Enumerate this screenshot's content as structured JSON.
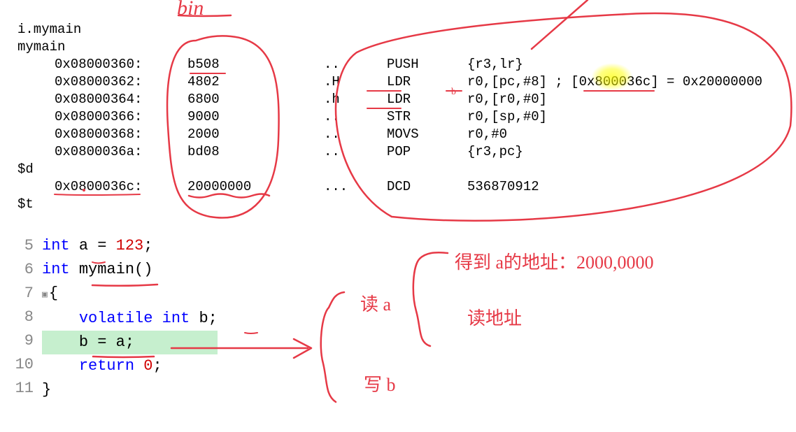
{
  "disasm": {
    "label1": "i.mymain",
    "label2": "mymain",
    "rows": [
      {
        "addr": "0x08000360:",
        "opcode": "b508",
        "ascii": "..",
        "mnem": "PUSH",
        "ops": "{r3,lr}"
      },
      {
        "addr": "0x08000362:",
        "opcode": "4802",
        "ascii": ".H",
        "mnem": "LDR",
        "ops": "r0,[pc,#8] ; [0x800036c] = 0x20000000"
      },
      {
        "addr": "0x08000364:",
        "opcode": "6800",
        "ascii": ".h",
        "mnem": "LDR",
        "ops": "r0,[r0,#0]"
      },
      {
        "addr": "0x08000366:",
        "opcode": "9000",
        "ascii": "..",
        "mnem": "STR",
        "ops": "r0,[sp,#0]"
      },
      {
        "addr": "0x08000368:",
        "opcode": "2000",
        "ascii": "..",
        "mnem": "MOVS",
        "ops": "r0,#0"
      },
      {
        "addr": "0x0800036a:",
        "opcode": "bd08",
        "ascii": "..",
        "mnem": "POP",
        "ops": "{r3,pc}"
      }
    ],
    "label3": "$d",
    "data_row": {
      "addr": "0x0800036c:",
      "opcode": "20000000",
      "ascii": "...",
      "mnem": "DCD",
      "ops": "536870912"
    },
    "label4": "$t"
  },
  "source": {
    "lines": [
      {
        "ln": "5",
        "tokens": [
          {
            "t": "int ",
            "c": "kw-blue"
          },
          {
            "t": "a ",
            "c": "token-black"
          },
          {
            "t": "= ",
            "c": "token-black"
          },
          {
            "t": "123",
            "c": "num-red"
          },
          {
            "t": ";",
            "c": "token-black"
          }
        ]
      },
      {
        "ln": "6",
        "tokens": [
          {
            "t": "int ",
            "c": "kw-blue"
          },
          {
            "t": "mymain",
            "c": "token-black"
          },
          {
            "t": "()",
            "c": "token-black"
          }
        ]
      },
      {
        "ln": "7",
        "fold": true,
        "tokens": [
          {
            "t": "{",
            "c": "token-black"
          }
        ]
      },
      {
        "ln": "8",
        "tokens": [
          {
            "t": "    ",
            "c": ""
          },
          {
            "t": "volatile ",
            "c": "kw-blue"
          },
          {
            "t": "int ",
            "c": "kw-blue"
          },
          {
            "t": "b",
            "c": "token-black"
          },
          {
            "t": ";",
            "c": "token-black"
          }
        ]
      },
      {
        "ln": "9",
        "hl": true,
        "tokens": [
          {
            "t": "    ",
            "c": ""
          },
          {
            "t": "b ",
            "c": "token-black"
          },
          {
            "t": "= ",
            "c": "token-black"
          },
          {
            "t": "a",
            "c": "token-black"
          },
          {
            "t": ";",
            "c": "token-black"
          }
        ]
      },
      {
        "ln": "10",
        "tokens": [
          {
            "t": "    ",
            "c": ""
          },
          {
            "t": "return ",
            "c": "kw-blue"
          },
          {
            "t": "0",
            "c": "num-red"
          },
          {
            "t": ";",
            "c": "token-black"
          }
        ]
      },
      {
        "ln": "11",
        "tokens": [
          {
            "t": "}",
            "c": "token-black"
          }
        ]
      }
    ]
  },
  "handwriting": {
    "bin": "bin",
    "read_a": "读 a",
    "get_addr_a": "得到 a的地址：2000,0000",
    "read_addr": "读地址",
    "write_b": "写 b"
  }
}
